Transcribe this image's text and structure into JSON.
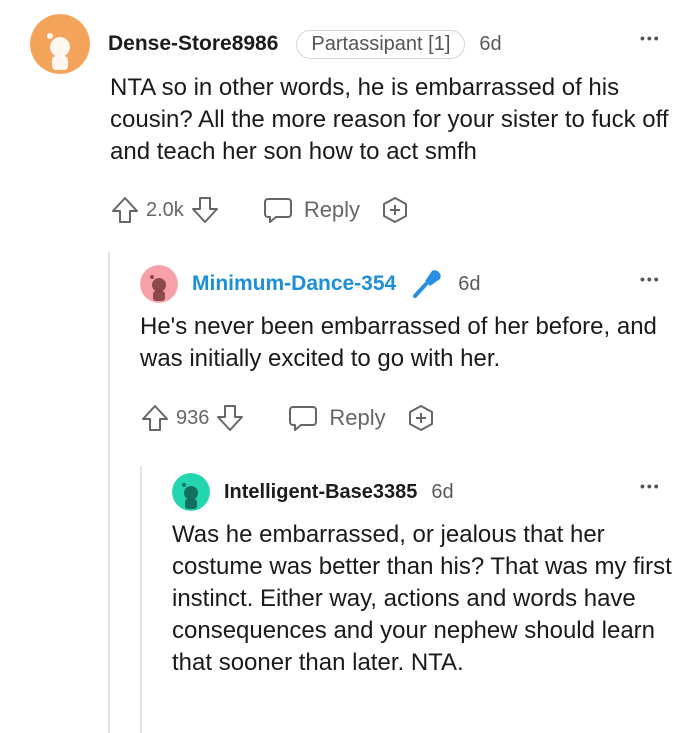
{
  "comments": [
    {
      "username": "Dense-Store8986",
      "flair": "Partassipant [1]",
      "age": "6d",
      "more": "•••",
      "body": "NTA so in other words, he is embarrassed of his cousin? All the more reason for your sister to fuck off and teach her son how to act smfh",
      "score": "2.0k",
      "reply_label": "Reply",
      "avatar_color": "#f4a35a"
    },
    {
      "username": "Minimum-Dance-354",
      "age": "6d",
      "more": "•••",
      "body": "He's never been embarrassed of her before, and was initially excited to go with her.",
      "score": "936",
      "reply_label": "Reply",
      "avatar_color": "#f7a0a8",
      "username_color": "#1d8fd6",
      "mic_color": "#2a8fe0"
    },
    {
      "username": "Intelligent-Base3385",
      "age": "6d",
      "more": "•••",
      "body": "Was he embarrassed, or jealous that her costume was better than his? That was my first instinct. Either way, actions and words have consequences and your nephew should learn that sooner than later. NTA.",
      "avatar_color": "#24d6b0"
    }
  ]
}
